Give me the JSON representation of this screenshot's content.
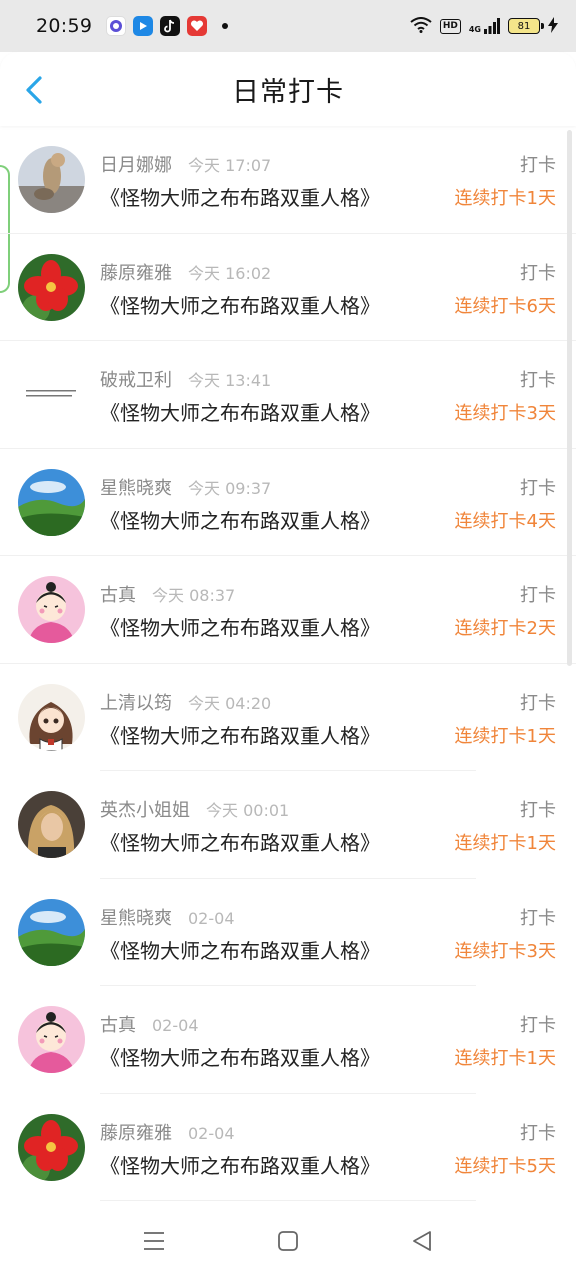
{
  "status_bar": {
    "time": "20:59",
    "hd_label": "HD",
    "network_label": "4G",
    "battery": "81",
    "accent_colors": {
      "app1": "#5b4fd6",
      "app2": "#1e88e5",
      "app3": "#111111",
      "app4": "#e53935"
    }
  },
  "header": {
    "title": "日常打卡",
    "back_icon": "chevron-left-icon"
  },
  "colors": {
    "accent_back": "#2aa6e8",
    "streak": "#f0853a",
    "muted": "#8a8a8a"
  },
  "items": [
    {
      "name": "日月娜娜",
      "time": "今天 17:07",
      "book": "《怪物大师之布布路双重人格》",
      "kind": "打卡",
      "streak": "连续打卡1天",
      "avatar": "cat-photo"
    },
    {
      "name": "藤原雍雅",
      "time": "今天 16:02",
      "book": "《怪物大师之布布路双重人格》",
      "kind": "打卡",
      "streak": "连续打卡6天",
      "avatar": "red-flower"
    },
    {
      "name": "破戒卫利",
      "time": "今天 13:41",
      "book": "《怪物大师之布布路双重人格》",
      "kind": "打卡",
      "streak": "连续打卡3天",
      "avatar": "text-note"
    },
    {
      "name": "星熊晓爽",
      "time": "今天 09:37",
      "book": "《怪物大师之布布路双重人格》",
      "kind": "打卡",
      "streak": "连续打卡4天",
      "avatar": "green-landscape"
    },
    {
      "name": "古真",
      "time": "今天 08:37",
      "book": "《怪物大师之布布路双重人格》",
      "kind": "打卡",
      "streak": "连续打卡2天",
      "avatar": "cartoon-girl"
    },
    {
      "name": "上清以筠",
      "time": "今天 04:20",
      "book": "《怪物大师之布布路双重人格》",
      "kind": "打卡",
      "streak": "连续打卡1天",
      "avatar": "anime-girl"
    },
    {
      "name": "英杰小姐姐",
      "time": "今天 00:01",
      "book": "《怪物大师之布布路双重人格》",
      "kind": "打卡",
      "streak": "连续打卡1天",
      "avatar": "portrait-photo"
    },
    {
      "name": "星熊晓爽",
      "time": "02-04",
      "book": "《怪物大师之布布路双重人格》",
      "kind": "打卡",
      "streak": "连续打卡3天",
      "avatar": "green-landscape"
    },
    {
      "name": "古真",
      "time": "02-04",
      "book": "《怪物大师之布布路双重人格》",
      "kind": "打卡",
      "streak": "连续打卡1天",
      "avatar": "cartoon-girl"
    },
    {
      "name": "藤原雍雅",
      "time": "02-04",
      "book": "《怪物大师之布布路双重人格》",
      "kind": "打卡",
      "streak": "连续打卡5天",
      "avatar": "red-flower"
    }
  ],
  "nav": {
    "menu_icon": "menu-icon",
    "home_icon": "home-square-icon",
    "back_icon": "back-triangle-icon"
  }
}
